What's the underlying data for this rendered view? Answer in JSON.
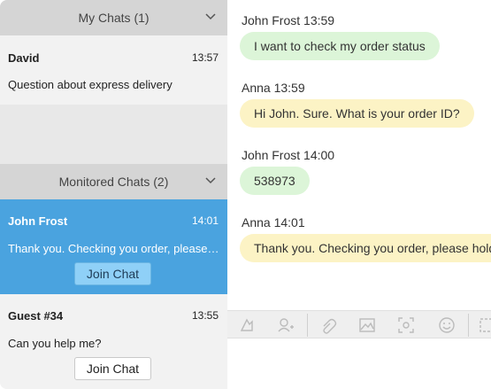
{
  "sections": {
    "my_chats": "My Chats (1)",
    "monitored": "Monitored Chats (2)"
  },
  "my_chats": [
    {
      "name": "David",
      "time": "13:57",
      "message": "Question about express delivery"
    }
  ],
  "monitored_chats": [
    {
      "name": "John Frost",
      "time": "14:01",
      "message": "Thank you. Checking you order, please hold",
      "button": "Join Chat",
      "selected": true
    },
    {
      "name": "Guest #34",
      "time": "13:55",
      "message": "Can you help me?",
      "button": "Join Chat",
      "selected": false
    }
  ],
  "conversation": [
    {
      "sender": "John Frost 13:59",
      "text": "I want to check my order status",
      "style": "customer"
    },
    {
      "sender": "Anna 13:59",
      "text": "Hi John. Sure. What is your order ID?",
      "style": "agent"
    },
    {
      "sender": "John Frost 14:00",
      "text": "538973",
      "style": "customer"
    },
    {
      "sender": "Anna 14:01",
      "text": "Thank you. Checking you order, please hold",
      "style": "agent"
    }
  ],
  "toolbar": {
    "icons": [
      "move-icon",
      "add-person-icon",
      "attachment-icon",
      "image-icon",
      "screenshot-icon",
      "emoji-icon",
      "more-icon"
    ]
  },
  "colors": {
    "selected_bg": "#4aa3df",
    "customer_bubble": "#dcf5d8",
    "agent_bubble": "#fcf3c5",
    "header_bg": "#d5d5d5"
  }
}
